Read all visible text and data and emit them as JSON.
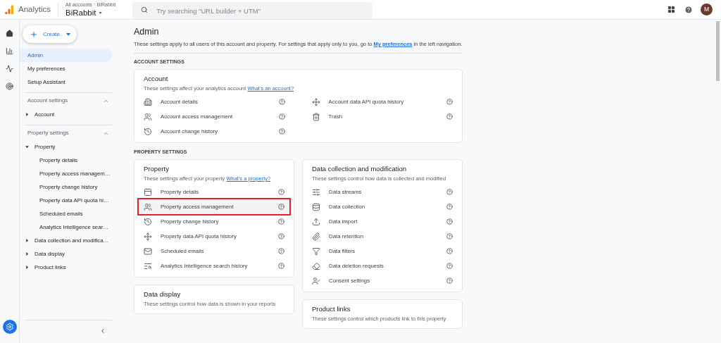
{
  "header": {
    "app_name": "Analytics",
    "breadcrumb": [
      "All accounts",
      "BiRabbit"
    ],
    "account": "BiRabbit",
    "search": {
      "placeholder": "Try searching \"URL builder + UTM\""
    },
    "avatar": "M"
  },
  "sidebar": {
    "create": "Create",
    "nav": [
      {
        "label": "Admin",
        "selected": true
      },
      {
        "label": "My preferences",
        "selected": false
      },
      {
        "label": "Setup Assistant",
        "selected": false
      }
    ],
    "sections": [
      {
        "title": "Account settings",
        "expanded": true,
        "items": [
          {
            "label": "Account",
            "expanded": false
          }
        ]
      },
      {
        "title": "Property settings",
        "expanded": true,
        "items": [
          {
            "label": "Property",
            "expanded": true,
            "children": [
              {
                "label": "Property details"
              },
              {
                "label": "Property access managem…"
              },
              {
                "label": "Property change history"
              },
              {
                "label": "Property data API quota hi…"
              },
              {
                "label": "Scheduled emails"
              },
              {
                "label": "Analytics Intelligence sear…"
              }
            ]
          },
          {
            "label": "Data collection and modifica…",
            "expanded": false
          },
          {
            "label": "Data display",
            "expanded": false
          },
          {
            "label": "Product links",
            "expanded": false
          }
        ]
      }
    ]
  },
  "main": {
    "title": "Admin",
    "intro_before": "These settings apply to all users of this account and property. For settings that apply only to you, go to ",
    "intro_link": "My preferences",
    "intro_after": " in the left navigation.",
    "account_settings": {
      "heading": "ACCOUNT SETTINGS",
      "card": {
        "title": "Account",
        "subtitle": "These settings affect your analytics account ",
        "link": "What's an account?",
        "items": [
          {
            "label": "Account details",
            "highlighted": false
          },
          {
            "label": "Account access management",
            "highlighted": false
          },
          {
            "label": "Account change history",
            "highlighted": false
          },
          {
            "label": "Account data API quota history",
            "highlighted": false
          },
          {
            "label": "Trash",
            "highlighted": false
          }
        ]
      }
    },
    "property_settings": {
      "heading": "PROPERTY SETTINGS",
      "cards": [
        {
          "title": "Property",
          "subtitle": "These settings affect your property ",
          "link": "What's a property?",
          "items": [
            {
              "label": "Property details",
              "highlighted": false
            },
            {
              "label": "Property access management",
              "highlighted": true
            },
            {
              "label": "Property change history",
              "highlighted": false
            },
            {
              "label": "Property data API quota history",
              "highlighted": false
            },
            {
              "label": "Scheduled emails",
              "highlighted": false
            },
            {
              "label": "Analytics Intelligence search history",
              "highlighted": false
            }
          ]
        },
        {
          "title": "Data collection and modification",
          "subtitle": "These settings control how data is collected and modified",
          "items": [
            {
              "label": "Data streams",
              "highlighted": false
            },
            {
              "label": "Data collection",
              "highlighted": false
            },
            {
              "label": "Data import",
              "highlighted": false
            },
            {
              "label": "Data retention",
              "highlighted": false
            },
            {
              "label": "Data filters",
              "highlighted": false
            },
            {
              "label": "Data deletion requests",
              "highlighted": false
            },
            {
              "label": "Consent settings",
              "highlighted": false
            }
          ]
        },
        {
          "title": "Data display",
          "subtitle": "These settings control how data is shown in your reports"
        },
        {
          "title": "Product links",
          "subtitle": "These settings control which products link to this property"
        }
      ]
    }
  }
}
